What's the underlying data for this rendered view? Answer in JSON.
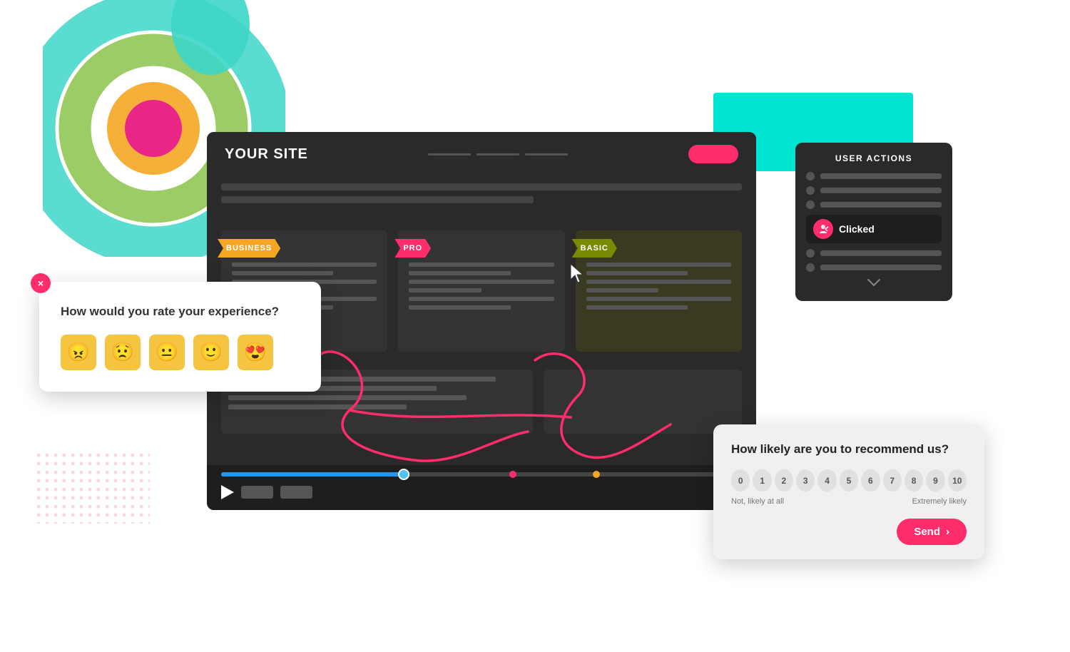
{
  "decorative": {
    "teal_rect": true,
    "dots_pattern": true
  },
  "video_player": {
    "site_title": "YOUR SITE",
    "pricing_cards": [
      {
        "label": "BUSINESS",
        "type": "business"
      },
      {
        "label": "PRO",
        "type": "pro"
      },
      {
        "label": "BASIC",
        "type": "basic"
      }
    ]
  },
  "user_actions_panel": {
    "title": "USER ACTIONS",
    "items": [
      {
        "active": false
      },
      {
        "active": false
      },
      {
        "active": false
      },
      {
        "active": true,
        "label": "Clicked"
      },
      {
        "active": false
      },
      {
        "active": false
      }
    ],
    "clicked_label": "Clicked",
    "chevron": "˅"
  },
  "survey_popup": {
    "question": "How would you rate your experience?",
    "close_label": "×",
    "emojis": [
      "😠",
      "😟",
      "😐",
      "🙂",
      "😍"
    ]
  },
  "nps_popup": {
    "question": "How likely are you to recommend us?",
    "numbers": [
      "0",
      "1",
      "2",
      "3",
      "4",
      "5",
      "6",
      "7",
      "8",
      "9",
      "10"
    ],
    "label_left": "Not, likely at all",
    "label_right": "Extremely likely",
    "send_label": "Send",
    "send_arrow": "›"
  }
}
